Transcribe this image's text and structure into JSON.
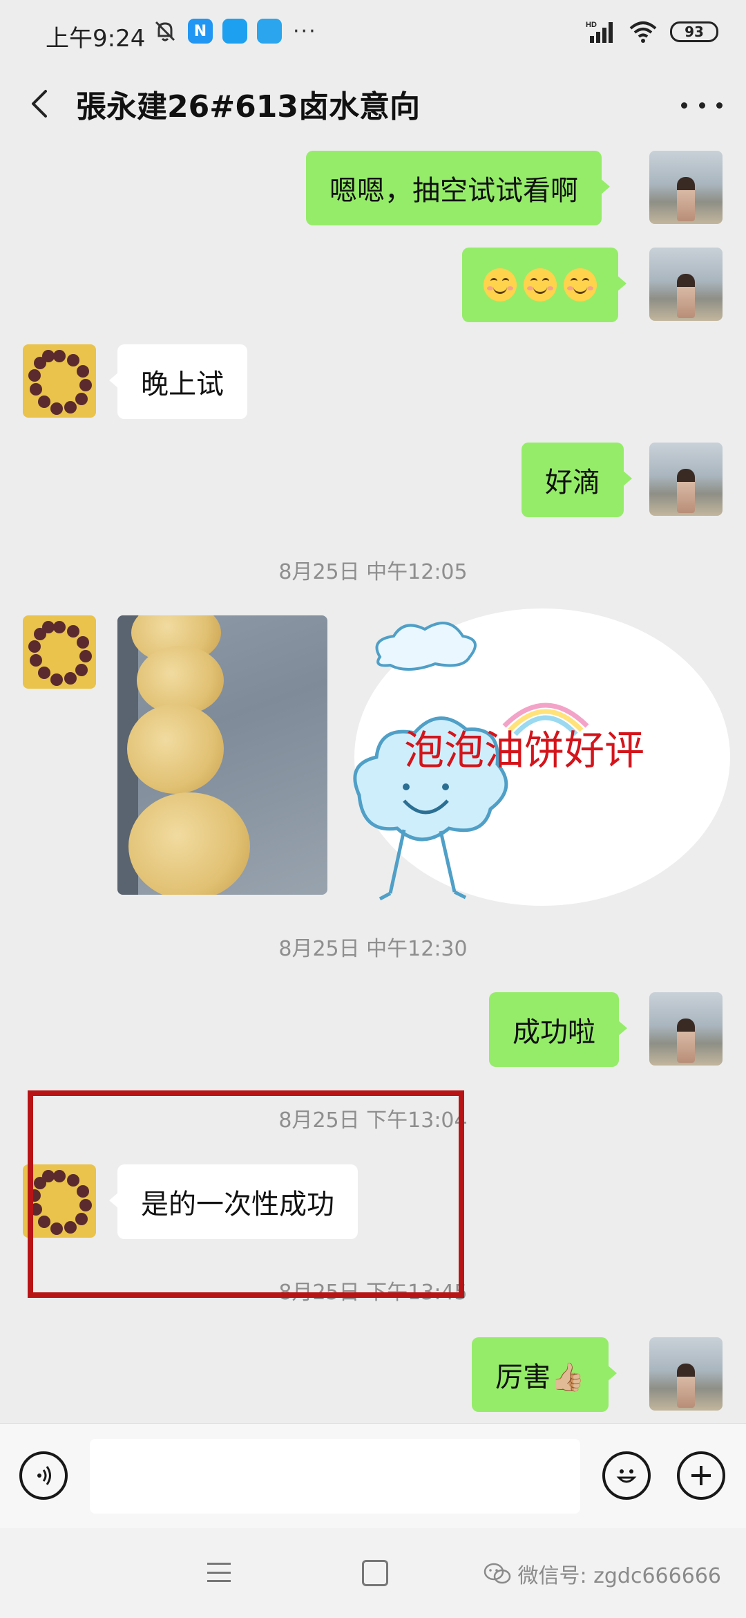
{
  "status_bar": {
    "time": "上午9:24",
    "battery": "93",
    "app_badges": [
      "N",
      "",
      ""
    ],
    "overflow": "···",
    "network": "HD"
  },
  "header": {
    "title": "張永建26#613卤水意向"
  },
  "messages": [
    {
      "side": "me",
      "text": "嗯嗯，抽空试试看啊"
    },
    {
      "side": "me",
      "type": "emoji",
      "count": 3
    },
    {
      "side": "other",
      "text": "晚上试"
    },
    {
      "side": "me",
      "text": "好滴"
    },
    {
      "type": "timestamp",
      "text": "8月25日 中午12:05"
    },
    {
      "side": "other",
      "type": "image",
      "icon": "food-photo"
    },
    {
      "side": "other",
      "type": "sticker",
      "text": "泡泡油饼好评"
    },
    {
      "type": "timestamp",
      "text": "8月25日 中午12:30"
    },
    {
      "side": "me",
      "text": "成功啦"
    },
    {
      "type": "timestamp",
      "text": "8月25日 下午13:04"
    },
    {
      "side": "other",
      "text": "是的一次性成功"
    },
    {
      "type": "timestamp",
      "text": "8月25日 下午13:45"
    },
    {
      "side": "me",
      "text": "厉害👍🏼"
    }
  ],
  "input_bar": {
    "voice_icon": "voice-icon",
    "emoji_icon": "emoji-icon",
    "plus_icon": "plus-icon"
  },
  "watermark": {
    "text": "微信号: zgdc666666"
  },
  "colors": {
    "my_bubble": "#95ec69",
    "other_bubble": "#ffffff",
    "highlight": "#b81416",
    "background": "#ededed"
  }
}
